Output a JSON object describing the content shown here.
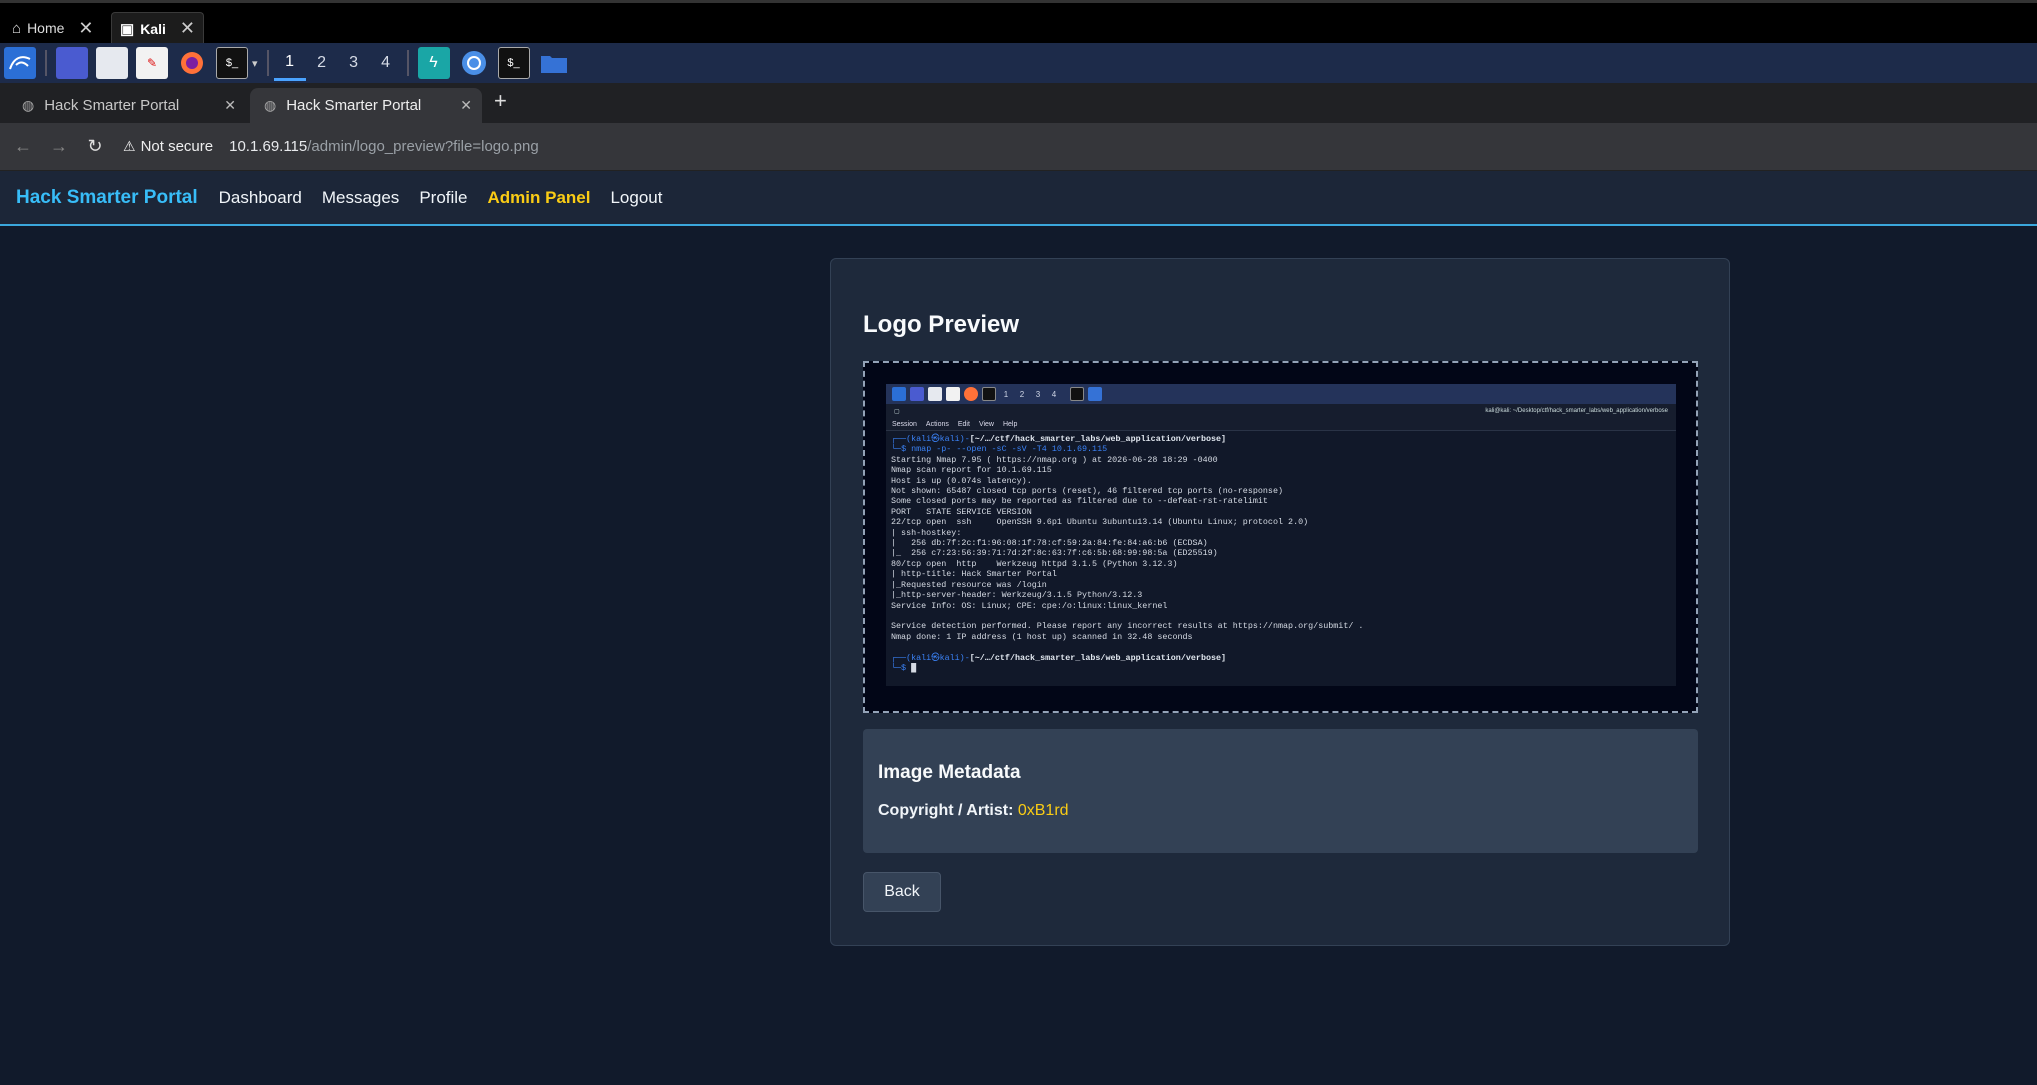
{
  "vm_tabs": [
    {
      "label": "Home",
      "icon": "home-icon"
    },
    {
      "label": "Kali",
      "icon": "vm-icon"
    }
  ],
  "panel": {
    "workspaces": [
      "1",
      "2",
      "3",
      "4"
    ],
    "active_workspace": "1"
  },
  "browser": {
    "tabs": [
      {
        "label": "Hack Smarter Portal"
      },
      {
        "label": "Hack Smarter Portal"
      }
    ],
    "new_tab": "+",
    "security": "Not secure",
    "url_host": "10.1.69.115",
    "url_path": "/admin/logo_preview?file=logo.png"
  },
  "site": {
    "brand": "Hack Smarter Portal",
    "nav": [
      "Dashboard",
      "Messages",
      "Profile",
      "Admin Panel",
      "Logout"
    ]
  },
  "card": {
    "title": "Logo Preview",
    "metadata_title": "Image Metadata",
    "metadata_label": "Copyright / Artist:",
    "metadata_value": "0xB1rd",
    "back_label": "Back"
  },
  "preview_shot": {
    "workspaces": [
      "1",
      "2",
      "3",
      "4"
    ],
    "window_title": "kali@kali: ~/Desktop/ctf/hack_smarter_labs/web_application/verbose",
    "menu": [
      "Session",
      "Actions",
      "Edit",
      "View",
      "Help"
    ],
    "prompt_user": "(kali㉿kali)",
    "prompt_path": "[~/…/ctf/hack_smarter_labs/web_application/verbose]",
    "command": "$ nmap -p- --open -sC -sV -T4 10.1.69.115",
    "output": [
      "Starting Nmap 7.95 ( https://nmap.org ) at 2026-06-28 18:29 -0400",
      "Nmap scan report for 10.1.69.115",
      "Host is up (0.074s latency).",
      "Not shown: 65487 closed tcp ports (reset), 46 filtered tcp ports (no-response)",
      "Some closed ports may be reported as filtered due to --defeat-rst-ratelimit",
      "PORT   STATE SERVICE VERSION",
      "22/tcp open  ssh     OpenSSH 9.6p1 Ubuntu 3ubuntu13.14 (Ubuntu Linux; protocol 2.0)",
      "| ssh-hostkey:",
      "|   256 db:7f:2c:f1:96:08:1f:78:cf:59:2a:84:fe:84:a6:b6 (ECDSA)",
      "|_  256 c7:23:56:39:71:7d:2f:8c:63:7f:c6:5b:68:99:98:5a (ED25519)",
      "80/tcp open  http    Werkzeug httpd 3.1.5 (Python 3.12.3)",
      "| http-title: Hack Smarter Portal",
      "|_Requested resource was /login",
      "|_http-server-header: Werkzeug/3.1.5 Python/3.12.3",
      "Service Info: OS: Linux; CPE: cpe:/o:linux:linux_kernel",
      "",
      "Service detection performed. Please report any incorrect results at https://nmap.org/submit/ .",
      "Nmap done: 1 IP address (1 host up) scanned in 32.48 seconds"
    ]
  },
  "colors": {
    "accent": "#38bdf8",
    "admin": "#facc15",
    "page_bg": "#111a2b",
    "card_bg": "#1e293b"
  }
}
